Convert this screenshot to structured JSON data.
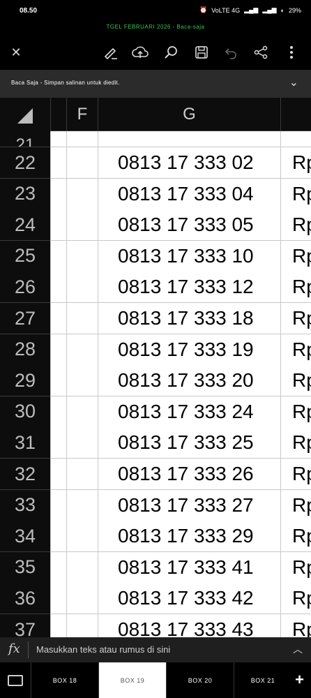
{
  "status_bar": {
    "time": "08.50",
    "network": "VoLTE 4G",
    "battery": "29%"
  },
  "doc_title": "TGEL FEBRUARI 2026 - Baca-saja",
  "toolbar": {
    "icons": [
      "close-icon",
      "pen-icon",
      "cloud-upload-icon",
      "search-icon",
      "save-icon",
      "undo-icon",
      "share-icon",
      "more-icon"
    ]
  },
  "notice": {
    "text": "Baca Saja - Simpan salinan untuk diedit."
  },
  "grid": {
    "columns": [
      "F",
      "G"
    ],
    "partial_row": "21",
    "rows": [
      {
        "num": "22",
        "g": "0813 17 333 02",
        "h": "Rp"
      },
      {
        "num": "23",
        "g": "0813 17 333 04",
        "h": "Rp"
      },
      {
        "num": "24",
        "g": "0813 17 333 05",
        "h": "Rp"
      },
      {
        "num": "25",
        "g": "0813 17 333 10",
        "h": "Rp"
      },
      {
        "num": "26",
        "g": "0813 17 333 12",
        "h": "Rp"
      },
      {
        "num": "27",
        "g": "0813 17 333 18",
        "h": "Rp"
      },
      {
        "num": "28",
        "g": "0813 17 333 19",
        "h": "Rp"
      },
      {
        "num": "29",
        "g": "0813 17 333 20",
        "h": "Rp"
      },
      {
        "num": "30",
        "g": "0813 17 333 24",
        "h": "Rp"
      },
      {
        "num": "31",
        "g": "0813 17 333 25",
        "h": "Rp"
      },
      {
        "num": "32",
        "g": "0813 17 333 26",
        "h": "Rp"
      },
      {
        "num": "33",
        "g": "0813 17 333 27",
        "h": "Rp"
      },
      {
        "num": "34",
        "g": "0813 17 333 29",
        "h": "Rp"
      },
      {
        "num": "35",
        "g": "0813 17 333 41",
        "h": "Rp"
      },
      {
        "num": "36",
        "g": "0813 17 333 42",
        "h": "Rp"
      },
      {
        "num": "37",
        "g": "0813 17 333 43",
        "h": "Rp"
      }
    ]
  },
  "formula_bar": {
    "placeholder": "Masukkan teks atau rumus di sini"
  },
  "sheet_tabs": {
    "tabs": [
      "BOX 18",
      "BOX 19",
      "BOX 20",
      "BOX 21"
    ],
    "active": "BOX 19"
  }
}
